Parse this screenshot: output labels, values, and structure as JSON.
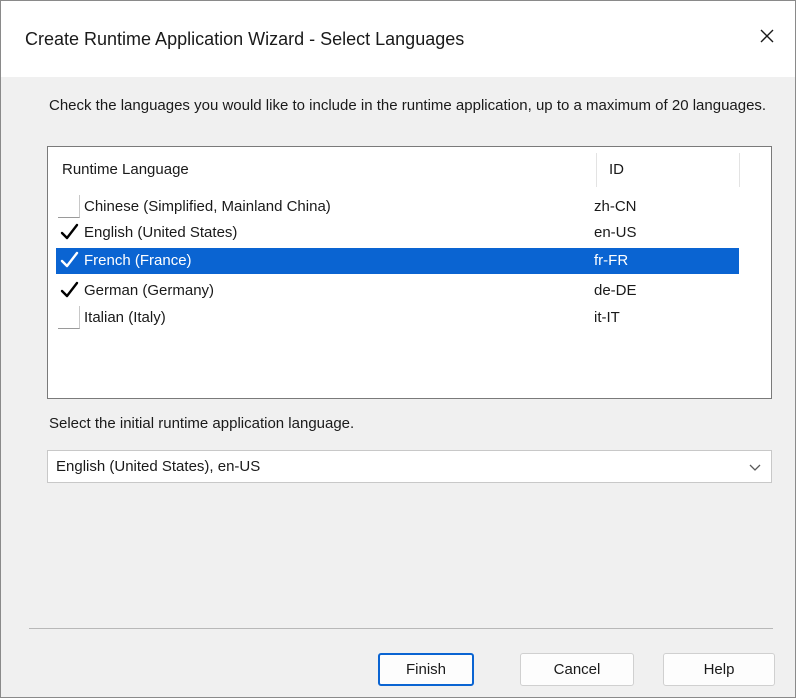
{
  "window": {
    "title": "Create Runtime Application Wizard - Select Languages",
    "close_icon": "close-icon"
  },
  "instructions": "Check the languages you would like to include in the runtime application, up to a maximum of 20 languages.",
  "language_list": {
    "columns": {
      "language": "Runtime Language",
      "id": "ID"
    },
    "rows": [
      {
        "language": "Chinese (Simplified, Mainland China)",
        "id": "zh-CN",
        "checked": false,
        "selected": false
      },
      {
        "language": "English (United States)",
        "id": "en-US",
        "checked": true,
        "selected": false
      },
      {
        "language": "French (France)",
        "id": "fr-FR",
        "checked": true,
        "selected": true
      },
      {
        "language": "German (Germany)",
        "id": "de-DE",
        "checked": true,
        "selected": false
      },
      {
        "language": "Italian (Italy)",
        "id": "it-IT",
        "checked": false,
        "selected": false
      }
    ]
  },
  "initial_language": {
    "label": "Select the initial runtime application language.",
    "selected_value": "English (United States), en-US"
  },
  "buttons": {
    "finish": "Finish",
    "cancel": "Cancel",
    "help": "Help"
  },
  "colors": {
    "selection": "#0a64d2",
    "dialog_background": "#f0f0f0"
  }
}
